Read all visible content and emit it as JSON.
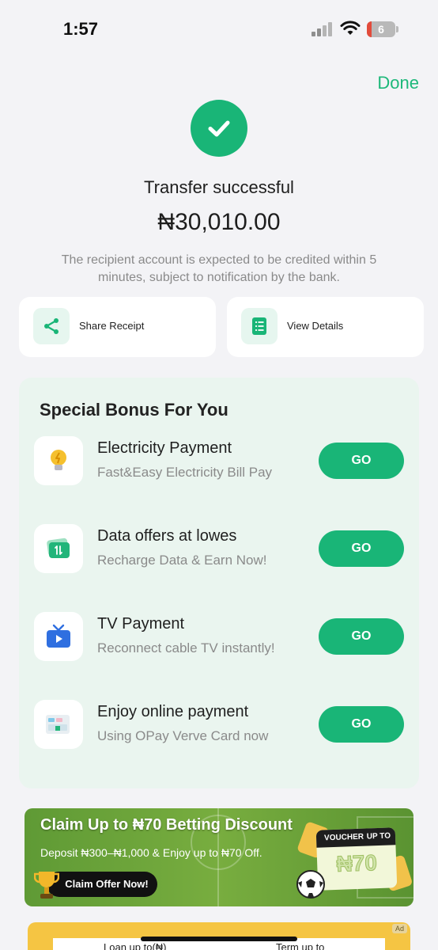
{
  "status_bar": {
    "time": "1:57",
    "battery": "6"
  },
  "header": {
    "done_label": "Done"
  },
  "result": {
    "title": "Transfer successful",
    "amount": "₦30,010.00",
    "note": "The recipient account is expected to be credited within 5 minutes, subject to notification by the bank."
  },
  "actions": [
    {
      "label": "Share Receipt",
      "icon": "share-icon"
    },
    {
      "label": "View Details",
      "icon": "details-list-icon"
    }
  ],
  "bonus": {
    "title": "Special Bonus For You",
    "items": [
      {
        "name": "Electricity Payment",
        "subtitle": "Fast&Easy Electricity Bill Pay",
        "button": "GO",
        "icon": "lightbulb-icon"
      },
      {
        "name": "Data offers at lowes",
        "subtitle": "Recharge Data & Earn Now!",
        "button": "GO",
        "icon": "data-card-icon"
      },
      {
        "name": "TV Payment",
        "subtitle": "Reconnect cable TV instantly!",
        "button": "GO",
        "icon": "tv-icon"
      },
      {
        "name": "Enjoy online payment",
        "subtitle": "Using OPay Verve Card now",
        "button": "GO",
        "icon": "card-icon"
      }
    ]
  },
  "promo": {
    "title": "Claim Up to ₦70 Betting Discount",
    "subtitle": "Deposit ₦300–₦1,000 & Enjoy up to ₦70 Off.",
    "button": "Claim Offer Now!",
    "voucher_label": "VOUCHER",
    "voucher_upto": "UP TO",
    "voucher_value": "₦70"
  },
  "bottom_ad": {
    "badge": "Ad",
    "loan_label": "Loan up to(₦)",
    "term_label": "Term up to"
  },
  "colors": {
    "accent": "#19b577",
    "panel": "#eaf5ef",
    "background": "#f3f3f6"
  }
}
